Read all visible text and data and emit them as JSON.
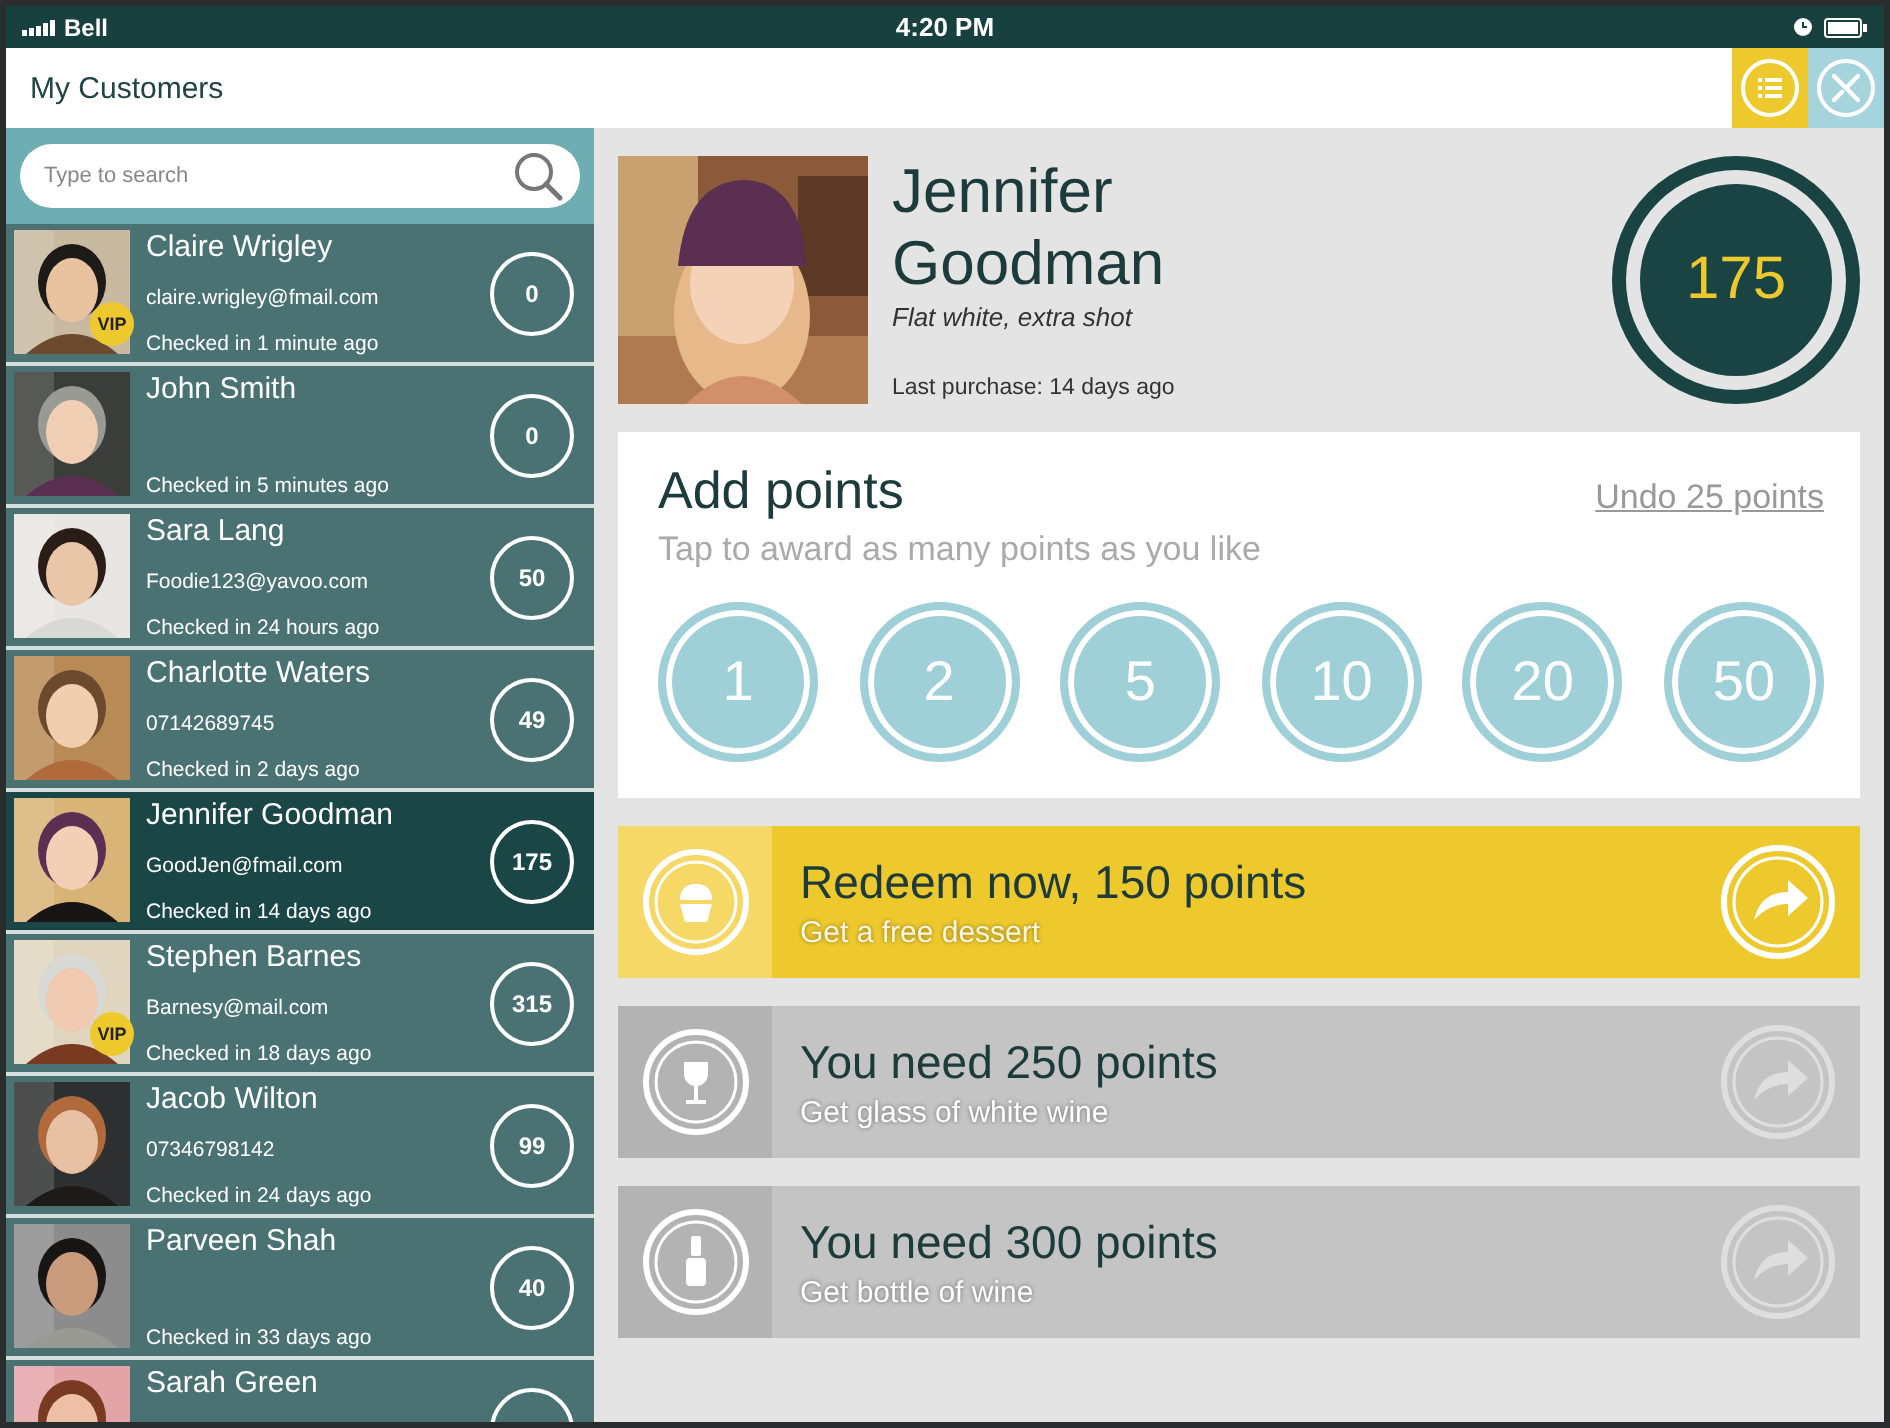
{
  "status_bar": {
    "carrier": "Bell",
    "time": "4:20 PM"
  },
  "header": {
    "title": "My Customers"
  },
  "search": {
    "placeholder": "Type to search"
  },
  "customers": [
    {
      "name": "Claire Wrigley",
      "contact": "claire.wrigley@fmail.com",
      "checked_in": "Checked in 1 minute ago",
      "points": "0",
      "vip": "VIP",
      "selected": false
    },
    {
      "name": "John Smith",
      "checked_in": "Checked in 5 minutes ago",
      "points": "0",
      "selected": false
    },
    {
      "name": "Sara Lang",
      "contact": "Foodie123@yavoo.com",
      "checked_in": "Checked in 24 hours ago",
      "points": "50",
      "selected": false
    },
    {
      "name": "Charlotte Waters",
      "contact": "07142689745",
      "checked_in": "Checked in 2 days ago",
      "points": "49",
      "selected": false
    },
    {
      "name": "Jennifer Goodman",
      "contact": "GoodJen@fmail.com",
      "checked_in": "Checked in 14 days ago",
      "points": "175",
      "selected": true
    },
    {
      "name": "Stephen Barnes",
      "contact": "Barnesy@mail.com",
      "checked_in": "Checked in 18 days ago",
      "points": "315",
      "vip": "VIP",
      "selected": false
    },
    {
      "name": "Jacob Wilton",
      "contact": "07346798142",
      "checked_in": "Checked in 24 days ago",
      "points": "99",
      "selected": false
    },
    {
      "name": "Parveen Shah",
      "checked_in": "Checked in 33 days ago",
      "points": "40",
      "selected": false
    },
    {
      "name": "Sarah Green",
      "selected": false
    }
  ],
  "profile": {
    "name": "Jennifer Goodman",
    "note": "Flat white, extra shot",
    "last_purchase": "Last purchase: 14 days ago",
    "points": "175"
  },
  "add_points": {
    "title": "Add points",
    "undo": "Undo 25 points",
    "hint": "Tap to award as many points as you like",
    "buttons": [
      "1",
      "2",
      "5",
      "10",
      "20",
      "50"
    ]
  },
  "rewards": [
    {
      "title": "Redeem now, 150 points",
      "subtitle": "Get a free dessert",
      "available": true
    },
    {
      "title": "You need 250 points",
      "subtitle": "Get glass of white wine",
      "available": false
    },
    {
      "title": "You need 300 points",
      "subtitle": "Get bottle of wine",
      "available": false
    }
  ]
}
